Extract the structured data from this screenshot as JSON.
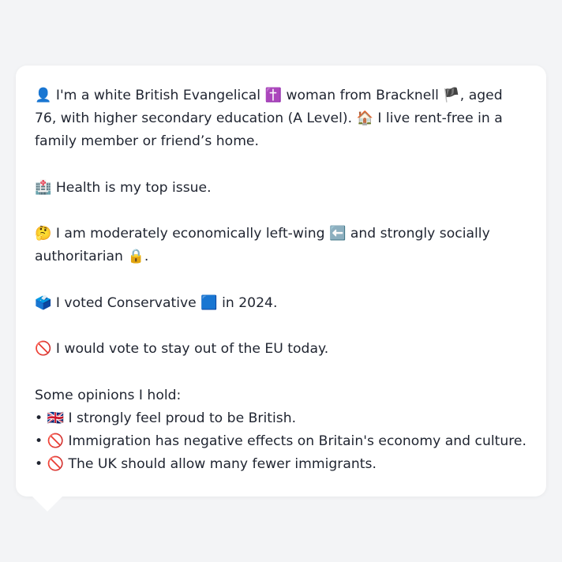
{
  "message": {
    "intro_icon": "👤",
    "intro_1": "I'm a white British Evangelical",
    "intro_icon_2": "✝️",
    "intro_2": "woman from Bracknell",
    "intro_icon_3": "🏴",
    "intro_3": ", aged 76, with higher secondary education (A Level).",
    "intro_icon_4": "🏠",
    "intro_4": "I live rent-free in a family member or friend’s home.",
    "health_icon": "🏥",
    "health_text": "Health is my top issue.",
    "politics_icon": "🤔",
    "politics_1": "I am moderately economically left-wing",
    "politics_icon_2": "⬅️",
    "politics_2": "and strongly socially authoritarian",
    "politics_icon_3": "🔒",
    "politics_3": ".",
    "vote_icon": "🗳️",
    "vote_1": "I voted Conservative",
    "vote_icon_2": "🟦",
    "vote_2": "in 2024.",
    "eu_icon": "🚫",
    "eu_text": "I would vote to stay out of the EU today.",
    "opinions_heading": "Some opinions I hold:",
    "opinions": [
      {
        "bullet": "•",
        "icon": "🇬🇧",
        "text": "I strongly feel proud to be British."
      },
      {
        "bullet": "•",
        "icon": "🚫",
        "text": "Immigration has negative effects on Britain's economy and culture."
      },
      {
        "bullet": "•",
        "icon": "🚫",
        "text": "The UK should allow many fewer immigrants."
      }
    ]
  }
}
